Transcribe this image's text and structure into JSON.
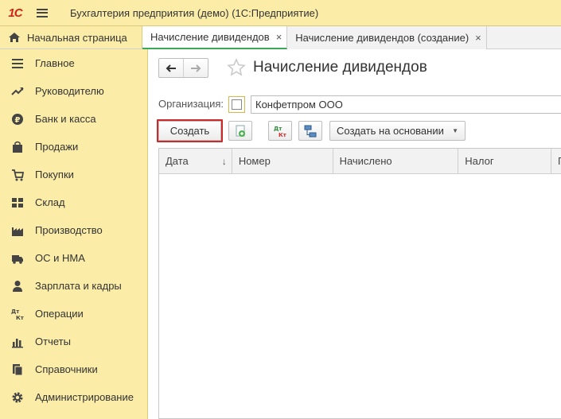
{
  "titlebar": {
    "logo": "1С",
    "title": "Бухгалтерия предприятия (демо)  (1С:Предприятие)"
  },
  "tabs": {
    "home_label": "Начальная страница",
    "items": [
      {
        "label": "Начисление дивидендов",
        "close": "×",
        "active": true
      },
      {
        "label": "Начисление дивидендов (создание)",
        "close": "×",
        "active": false
      }
    ]
  },
  "sidebar": {
    "items": [
      {
        "label": "Главное",
        "icon": "list-icon"
      },
      {
        "label": "Руководителю",
        "icon": "trend-icon"
      },
      {
        "label": "Банк и касса",
        "icon": "coin-icon"
      },
      {
        "label": "Продажи",
        "icon": "bag-icon"
      },
      {
        "label": "Покупки",
        "icon": "cart-icon"
      },
      {
        "label": "Склад",
        "icon": "grid-icon"
      },
      {
        "label": "Производство",
        "icon": "factory-icon"
      },
      {
        "label": "ОС и НМА",
        "icon": "truck-icon"
      },
      {
        "label": "Зарплата и кадры",
        "icon": "person-icon"
      },
      {
        "label": "Операции",
        "icon": "dt-kt-icon"
      },
      {
        "label": "Отчеты",
        "icon": "bar-chart-icon"
      },
      {
        "label": "Справочники",
        "icon": "book-icon"
      },
      {
        "label": "Администрирование",
        "icon": "gear-icon"
      }
    ]
  },
  "form": {
    "title": "Начисление дивидендов",
    "org_label": "Организация:",
    "org_value": "Конфетпром ООО",
    "create_label": "Создать",
    "basis_label": "Создать на основании",
    "dtkt_top": "Дт",
    "dtkt_bottom": "Кт"
  },
  "table": {
    "columns": [
      "Дата",
      "Номер",
      "Начислено",
      "Налог",
      "П"
    ],
    "sort_indicator": "↓"
  },
  "colors": {
    "accent_yellow": "#fbeda8",
    "active_tab_underline": "#3aa858",
    "highlight_red": "#cc2a2a"
  }
}
